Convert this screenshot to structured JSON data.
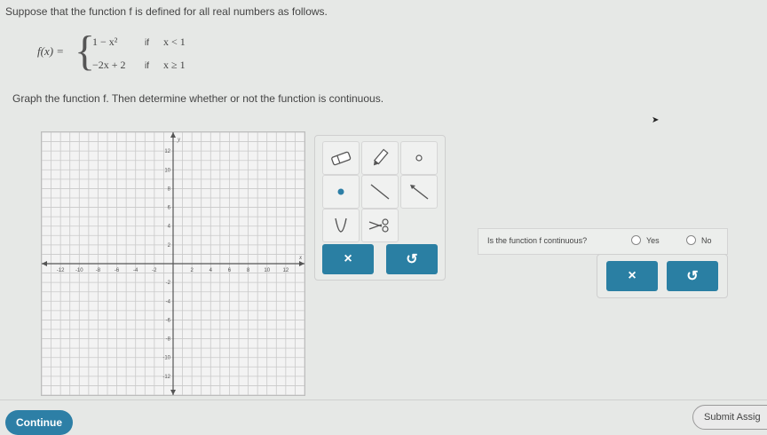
{
  "prompt_text": "Suppose that the function f is defined for all real numbers as follows.",
  "function": {
    "lhs": "f(x) =",
    "brace": "{",
    "pieces": [
      {
        "expr": "1 − x²",
        "if": "if",
        "cond": "x < 1"
      },
      {
        "expr": "−2x + 2",
        "if": "if",
        "cond": "x ≥ 1"
      }
    ]
  },
  "instruction": "Graph the function f. Then determine whether or not the function is continuous.",
  "graph": {
    "axis_labels": {
      "x": "x",
      "y": "y"
    },
    "x_ticks": [
      "-12",
      "-10",
      "-8",
      "-6",
      "-4",
      "-2",
      "2",
      "4",
      "6",
      "8",
      "10",
      "12"
    ],
    "y_ticks": [
      "12",
      "10",
      "8",
      "6",
      "4",
      "2",
      "-2",
      "-4",
      "-6",
      "-8",
      "-10",
      "-12"
    ],
    "range": {
      "xmin": -14,
      "xmax": 14,
      "ymin": -14,
      "ymax": 14
    }
  },
  "toolbox": {
    "tools": [
      "eraser-icon",
      "pencil-icon",
      "open-point-icon",
      "closed-point-icon",
      "segment-icon",
      "ray-icon",
      "parabola-icon",
      "scissors-icon"
    ],
    "clear_label": "×",
    "undo_label": "↺"
  },
  "question": {
    "text": "Is the function f continuous?",
    "options": [
      "Yes",
      "No"
    ],
    "clear_label": "×",
    "undo_label": "↺"
  },
  "footer": {
    "continue_label": "Continue",
    "submit_label": "Submit Assig"
  },
  "colors": {
    "accent": "#2d7fa6",
    "background": "#e6e8e6"
  }
}
